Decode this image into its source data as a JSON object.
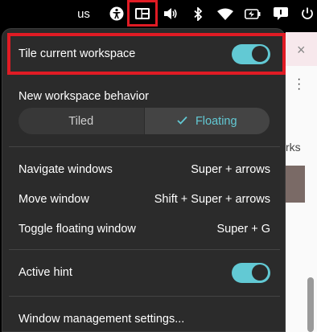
{
  "topbar": {
    "keyboard_layout": "us",
    "icons": [
      "accessibility-icon",
      "tiling-icon",
      "volume-icon",
      "bluetooth-icon",
      "wifi-icon",
      "battery-icon",
      "notification-icon",
      "power-icon"
    ]
  },
  "menu": {
    "tile_current_workspace": {
      "label": "Tile current workspace",
      "enabled": true
    },
    "new_workspace_behavior": {
      "title": "New workspace behavior",
      "options": [
        "Tiled",
        "Floating"
      ],
      "selected": "Floating"
    },
    "shortcuts": [
      {
        "label": "Navigate windows",
        "keys": "Super + arrows"
      },
      {
        "label": "Move window",
        "keys": "Shift + Super + arrows"
      },
      {
        "label": "Toggle floating window",
        "keys": "Super + G"
      }
    ],
    "active_hint": {
      "label": "Active hint",
      "enabled": true
    },
    "settings_link": "Window management settings..."
  },
  "background_window": {
    "close_glyph": "×",
    "partial_text": "rks"
  },
  "colors": {
    "accent": "#62c9d4",
    "highlight_box": "#e01b24",
    "popup_bg": "#2b2b2b"
  }
}
